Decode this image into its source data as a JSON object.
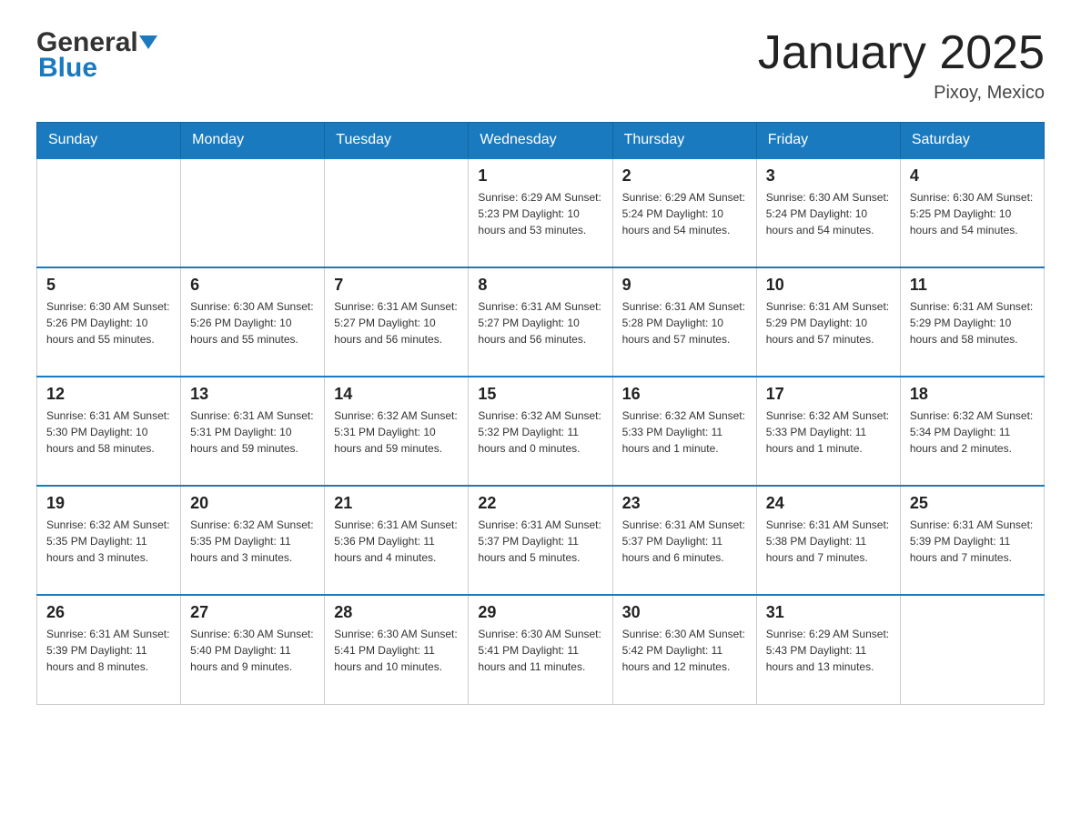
{
  "header": {
    "logo_general": "General",
    "logo_blue": "Blue",
    "title": "January 2025",
    "location": "Pixoy, Mexico"
  },
  "days_of_week": [
    "Sunday",
    "Monday",
    "Tuesday",
    "Wednesday",
    "Thursday",
    "Friday",
    "Saturday"
  ],
  "weeks": [
    [
      {
        "day": "",
        "info": ""
      },
      {
        "day": "",
        "info": ""
      },
      {
        "day": "",
        "info": ""
      },
      {
        "day": "1",
        "info": "Sunrise: 6:29 AM\nSunset: 5:23 PM\nDaylight: 10 hours and 53 minutes."
      },
      {
        "day": "2",
        "info": "Sunrise: 6:29 AM\nSunset: 5:24 PM\nDaylight: 10 hours and 54 minutes."
      },
      {
        "day": "3",
        "info": "Sunrise: 6:30 AM\nSunset: 5:24 PM\nDaylight: 10 hours and 54 minutes."
      },
      {
        "day": "4",
        "info": "Sunrise: 6:30 AM\nSunset: 5:25 PM\nDaylight: 10 hours and 54 minutes."
      }
    ],
    [
      {
        "day": "5",
        "info": "Sunrise: 6:30 AM\nSunset: 5:26 PM\nDaylight: 10 hours and 55 minutes."
      },
      {
        "day": "6",
        "info": "Sunrise: 6:30 AM\nSunset: 5:26 PM\nDaylight: 10 hours and 55 minutes."
      },
      {
        "day": "7",
        "info": "Sunrise: 6:31 AM\nSunset: 5:27 PM\nDaylight: 10 hours and 56 minutes."
      },
      {
        "day": "8",
        "info": "Sunrise: 6:31 AM\nSunset: 5:27 PM\nDaylight: 10 hours and 56 minutes."
      },
      {
        "day": "9",
        "info": "Sunrise: 6:31 AM\nSunset: 5:28 PM\nDaylight: 10 hours and 57 minutes."
      },
      {
        "day": "10",
        "info": "Sunrise: 6:31 AM\nSunset: 5:29 PM\nDaylight: 10 hours and 57 minutes."
      },
      {
        "day": "11",
        "info": "Sunrise: 6:31 AM\nSunset: 5:29 PM\nDaylight: 10 hours and 58 minutes."
      }
    ],
    [
      {
        "day": "12",
        "info": "Sunrise: 6:31 AM\nSunset: 5:30 PM\nDaylight: 10 hours and 58 minutes."
      },
      {
        "day": "13",
        "info": "Sunrise: 6:31 AM\nSunset: 5:31 PM\nDaylight: 10 hours and 59 minutes."
      },
      {
        "day": "14",
        "info": "Sunrise: 6:32 AM\nSunset: 5:31 PM\nDaylight: 10 hours and 59 minutes."
      },
      {
        "day": "15",
        "info": "Sunrise: 6:32 AM\nSunset: 5:32 PM\nDaylight: 11 hours and 0 minutes."
      },
      {
        "day": "16",
        "info": "Sunrise: 6:32 AM\nSunset: 5:33 PM\nDaylight: 11 hours and 1 minute."
      },
      {
        "day": "17",
        "info": "Sunrise: 6:32 AM\nSunset: 5:33 PM\nDaylight: 11 hours and 1 minute."
      },
      {
        "day": "18",
        "info": "Sunrise: 6:32 AM\nSunset: 5:34 PM\nDaylight: 11 hours and 2 minutes."
      }
    ],
    [
      {
        "day": "19",
        "info": "Sunrise: 6:32 AM\nSunset: 5:35 PM\nDaylight: 11 hours and 3 minutes."
      },
      {
        "day": "20",
        "info": "Sunrise: 6:32 AM\nSunset: 5:35 PM\nDaylight: 11 hours and 3 minutes."
      },
      {
        "day": "21",
        "info": "Sunrise: 6:31 AM\nSunset: 5:36 PM\nDaylight: 11 hours and 4 minutes."
      },
      {
        "day": "22",
        "info": "Sunrise: 6:31 AM\nSunset: 5:37 PM\nDaylight: 11 hours and 5 minutes."
      },
      {
        "day": "23",
        "info": "Sunrise: 6:31 AM\nSunset: 5:37 PM\nDaylight: 11 hours and 6 minutes."
      },
      {
        "day": "24",
        "info": "Sunrise: 6:31 AM\nSunset: 5:38 PM\nDaylight: 11 hours and 7 minutes."
      },
      {
        "day": "25",
        "info": "Sunrise: 6:31 AM\nSunset: 5:39 PM\nDaylight: 11 hours and 7 minutes."
      }
    ],
    [
      {
        "day": "26",
        "info": "Sunrise: 6:31 AM\nSunset: 5:39 PM\nDaylight: 11 hours and 8 minutes."
      },
      {
        "day": "27",
        "info": "Sunrise: 6:30 AM\nSunset: 5:40 PM\nDaylight: 11 hours and 9 minutes."
      },
      {
        "day": "28",
        "info": "Sunrise: 6:30 AM\nSunset: 5:41 PM\nDaylight: 11 hours and 10 minutes."
      },
      {
        "day": "29",
        "info": "Sunrise: 6:30 AM\nSunset: 5:41 PM\nDaylight: 11 hours and 11 minutes."
      },
      {
        "day": "30",
        "info": "Sunrise: 6:30 AM\nSunset: 5:42 PM\nDaylight: 11 hours and 12 minutes."
      },
      {
        "day": "31",
        "info": "Sunrise: 6:29 AM\nSunset: 5:43 PM\nDaylight: 11 hours and 13 minutes."
      },
      {
        "day": "",
        "info": ""
      }
    ]
  ]
}
